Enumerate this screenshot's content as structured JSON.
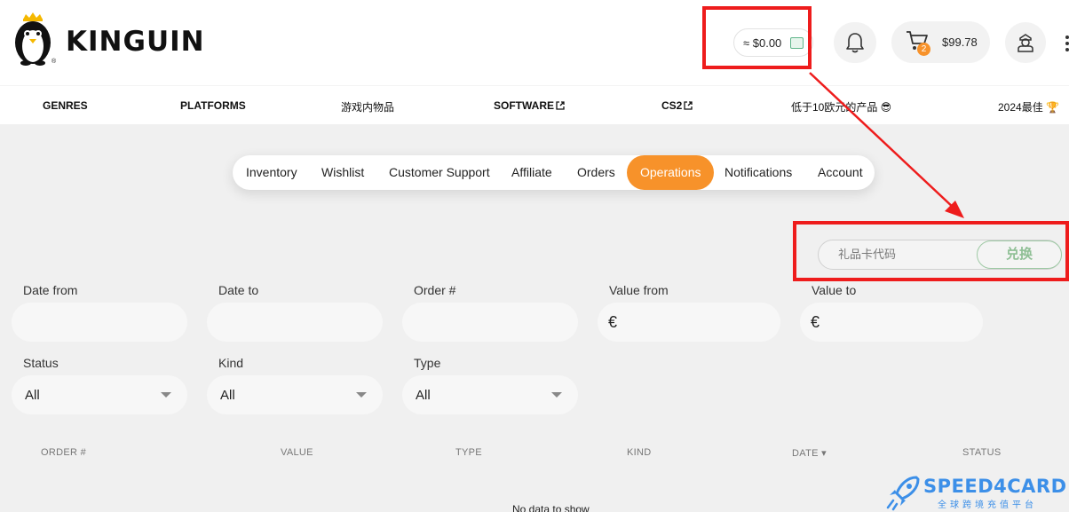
{
  "brand": {
    "name": "KINGUIN"
  },
  "header": {
    "wallet_balance": "≈ $0.00",
    "cart_count": "2",
    "cart_total": "$99.78"
  },
  "nav": {
    "items": [
      {
        "label": "GENRES"
      },
      {
        "label": "PLATFORMS"
      },
      {
        "label": "游戏内物品"
      },
      {
        "label": "SOFTWARE"
      },
      {
        "label": "CS2"
      },
      {
        "label": "低于10欧元的产品 😎"
      },
      {
        "label": "2024最佳 🏆"
      }
    ]
  },
  "tabs": [
    {
      "label": "Inventory"
    },
    {
      "label": "Wishlist"
    },
    {
      "label": "Customer Support"
    },
    {
      "label": "Affiliate"
    },
    {
      "label": "Orders"
    },
    {
      "label": "Operations",
      "active": true
    },
    {
      "label": "Notifications"
    },
    {
      "label": "Account"
    }
  ],
  "gift_card": {
    "placeholder": "礼品卡代码",
    "button_label": "兑换"
  },
  "filters": {
    "date_from": {
      "label": "Date from",
      "value": ""
    },
    "date_to": {
      "label": "Date to",
      "value": ""
    },
    "order_no": {
      "label": "Order #",
      "value": ""
    },
    "value_from": {
      "label": "Value from",
      "prefix": "€"
    },
    "value_to": {
      "label": "Value to",
      "prefix": "€"
    },
    "status": {
      "label": "Status",
      "selected": "All"
    },
    "kind": {
      "label": "Kind",
      "selected": "All"
    },
    "type": {
      "label": "Type",
      "selected": "All"
    }
  },
  "table": {
    "columns": [
      "ORDER #",
      "VALUE",
      "TYPE",
      "KIND",
      "DATE ▾",
      "STATUS"
    ],
    "empty_text": "No data to show"
  },
  "watermark": {
    "name": "SPEED4CARD",
    "tagline": "全球跨境充值平台"
  },
  "colors": {
    "accent": "#f7922a",
    "annotation": "#ee1c1c",
    "watermark": "#3c8fe8"
  }
}
